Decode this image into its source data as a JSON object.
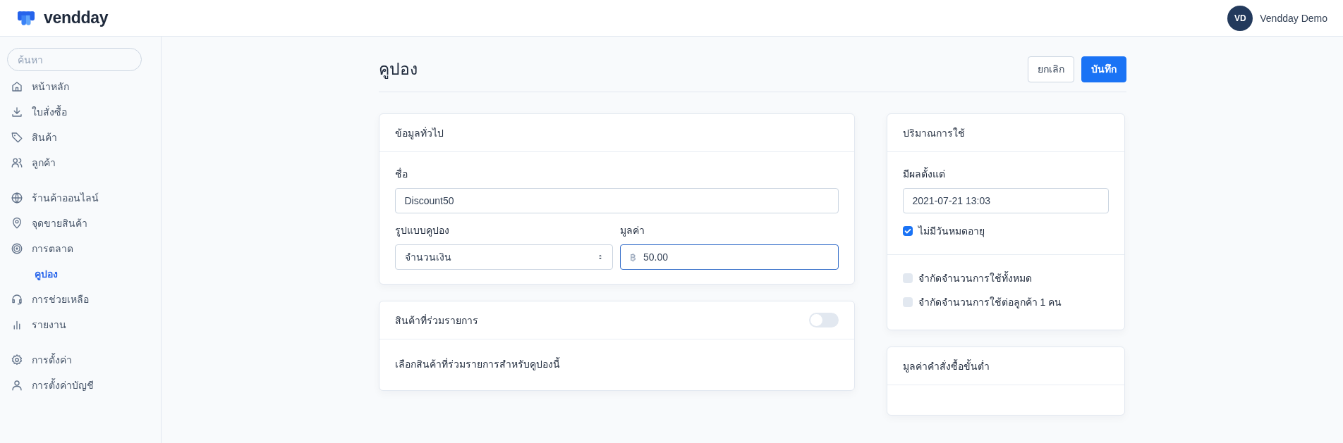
{
  "header": {
    "brand": "vendday",
    "user": {
      "initials": "VD",
      "name": "Vendday Demo"
    }
  },
  "sidebar": {
    "search": {
      "placeholder": "ค้นหา"
    },
    "groups": [
      {
        "items": [
          {
            "label": "หน้าหลัก",
            "selected": false
          },
          {
            "label": "ใบสั่งซื้อ",
            "selected": false
          },
          {
            "label": "สินค้า",
            "selected": false
          },
          {
            "label": "ลูกค้า",
            "selected": false
          }
        ]
      },
      {
        "items": [
          {
            "label": "ร้านค้าออนไลน์",
            "selected": false
          },
          {
            "label": "จุดขายสินค้า",
            "selected": false
          },
          {
            "label": "การตลาด",
            "selected": false,
            "children": [
              {
                "label": "คูปอง",
                "selected": true
              }
            ]
          },
          {
            "label": "การช่วยเหลือ",
            "selected": false
          },
          {
            "label": "รายงาน",
            "selected": false
          }
        ]
      },
      {
        "items": [
          {
            "label": "การตั้งค่า",
            "selected": false
          },
          {
            "label": "การตั้งค่าบัญชี",
            "selected": false
          }
        ]
      }
    ]
  },
  "page": {
    "title": "คูปอง",
    "buttons": [
      {
        "label": "ยกเลิก",
        "kind": "secondary"
      },
      {
        "label": "บันทึก",
        "kind": "primary"
      }
    ]
  },
  "general_card": {
    "title": "ข้อมูลทั่วไป",
    "name_field": {
      "label": "ชื่อ",
      "value": "Discount50"
    },
    "type_field": {
      "label": "รูปแบบคูปอง",
      "value": "จำนวนเงิน"
    },
    "amount_field": {
      "label": "มูลค่า",
      "prefix": "฿",
      "value": "50.00",
      "focused": true
    }
  },
  "products_card": {
    "title": "สินค้าที่ร่วมรายการ",
    "toggle": {
      "on": false
    },
    "description": "เลือกสินค้าที่ร่วมรายการสำหรับคูปองนี้"
  },
  "usage_card": {
    "title": "ปริมาณการใช้",
    "start_field": {
      "label": "มีผลตั้งแต่",
      "value": "2021-07-21 13:03"
    },
    "no_expiry": {
      "label": "ไม่มีวันหมดอายุ",
      "checked": true
    },
    "limits": [
      {
        "label": "จำกัดจำนวนการใช้ทั้งหมด",
        "checked": false
      },
      {
        "label": "จำกัดจำนวนการใช้ต่อลูกค้า 1 คน",
        "checked": false
      }
    ]
  },
  "minimum_card": {
    "title": "มูลค่าคำสั่งซื้อขั้นต่ำ"
  }
}
